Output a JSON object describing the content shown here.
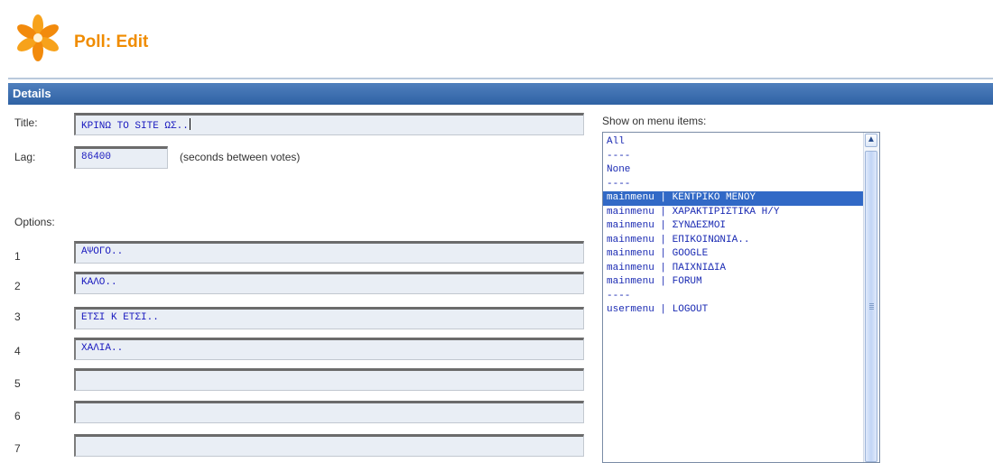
{
  "header": {
    "title": "Poll: Edit"
  },
  "section": {
    "title": "Details"
  },
  "form": {
    "title_label": "Title:",
    "title_value": "ΚΡΙΝΩ ΤΟ SITE ΩΣ..",
    "lag_label": "Lag:",
    "lag_value": "86400",
    "lag_hint": "(seconds between votes)",
    "options_label": "Options:",
    "options": [
      {
        "num": "1",
        "value": "ΑΨΟΓΟ.."
      },
      {
        "num": "2",
        "value": "ΚΑΛΟ.."
      },
      {
        "num": "3",
        "value": "ΕΤΣΙ Κ ΕΤΣΙ.."
      },
      {
        "num": "4",
        "value": "ΧΑΛΙΑ.."
      },
      {
        "num": "5",
        "value": ""
      },
      {
        "num": "6",
        "value": ""
      },
      {
        "num": "7",
        "value": ""
      }
    ]
  },
  "menu_items": {
    "label": "Show on menu items:",
    "items": [
      {
        "text": "All",
        "selected": false
      },
      {
        "text": "----",
        "selected": false
      },
      {
        "text": "None",
        "selected": false
      },
      {
        "text": "----",
        "selected": false
      },
      {
        "text": "mainmenu | ΚΕΝΤΡΙΚΟ ΜΕΝΟΥ",
        "selected": true
      },
      {
        "text": "mainmenu | ΧΑΡΑΚΤΙΡΙΣΤΙΚΑ Η/Υ",
        "selected": false
      },
      {
        "text": "mainmenu | ΣΥΝΔΕΣΜΟΙ",
        "selected": false
      },
      {
        "text": "mainmenu | ΕΠΙΚΟΙΝΩΝΙΑ..",
        "selected": false
      },
      {
        "text": "mainmenu | GOOGLE",
        "selected": false
      },
      {
        "text": "mainmenu | ΠΑΙΧΝΙΔΙΑ",
        "selected": false
      },
      {
        "text": "mainmenu | FORUM",
        "selected": false
      },
      {
        "text": "----",
        "selected": false
      },
      {
        "text": "usermenu | LOGOUT",
        "selected": false
      }
    ]
  },
  "colors": {
    "accent": "#f08c00",
    "bar": "#2f62a4",
    "selected": "#3169c6",
    "field_text": "#1a1abf"
  },
  "icons": {
    "logo": "orange-flower-logo-icon",
    "scroll_up": "chevron-up-icon"
  }
}
